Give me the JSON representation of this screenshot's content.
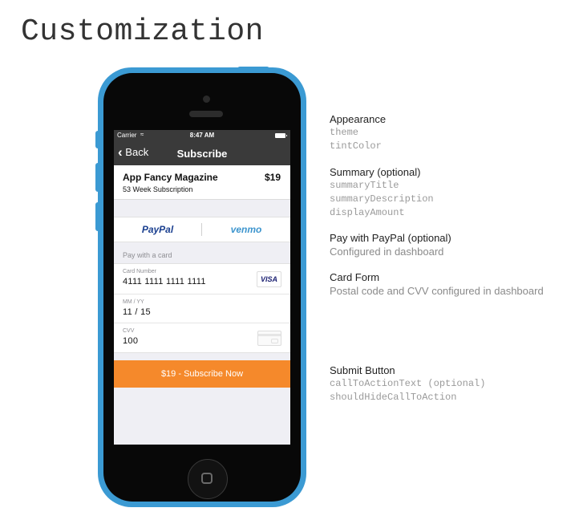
{
  "page_title": "Customization",
  "status_bar": {
    "carrier": "Carrier",
    "time": "8:47 AM",
    "wifi_icon": "wifi-icon",
    "battery_icon": "battery-icon"
  },
  "nav": {
    "back_label": "Back",
    "title": "Subscribe",
    "back_icon": "chevron-left-icon"
  },
  "summary": {
    "title": "App Fancy Magazine",
    "description": "53 Week Subscription",
    "amount": "$19"
  },
  "payment_methods": {
    "paypal": "PayPal",
    "venmo": "venmo"
  },
  "card_form": {
    "header": "Pay with a card",
    "card_number": {
      "label": "Card Number",
      "value": "4111 1111 1111 1111",
      "brand": "VISA"
    },
    "expiry": {
      "label": "MM / YY",
      "value": "11 / 15"
    },
    "cvv": {
      "label": "CVV",
      "value": "100"
    }
  },
  "cta": {
    "label": "$19 - Subscribe Now",
    "color": "#f5892b"
  },
  "annotations": {
    "appearance": {
      "heading": "Appearance",
      "items": [
        "theme",
        "tintColor"
      ]
    },
    "summary": {
      "heading": "Summary (optional)",
      "items": [
        "summaryTitle",
        "summaryDescription",
        "displayAmount"
      ]
    },
    "paypal": {
      "heading": "Pay with PayPal (optional)",
      "sub": "Configured in dashboard"
    },
    "card_form": {
      "heading": "Card Form",
      "sub": "Postal code and CVV configured in dashboard"
    },
    "submit": {
      "heading": "Submit Button",
      "items": [
        "callToActionText (optional)",
        "shouldHideCallToAction"
      ]
    }
  },
  "colors": {
    "device": "#3b9ad3",
    "nav_bar": "#3a3a3a",
    "screen_bg": "#efeff4",
    "paypal": "#1a3f8f",
    "venmo": "#3d95ce"
  }
}
